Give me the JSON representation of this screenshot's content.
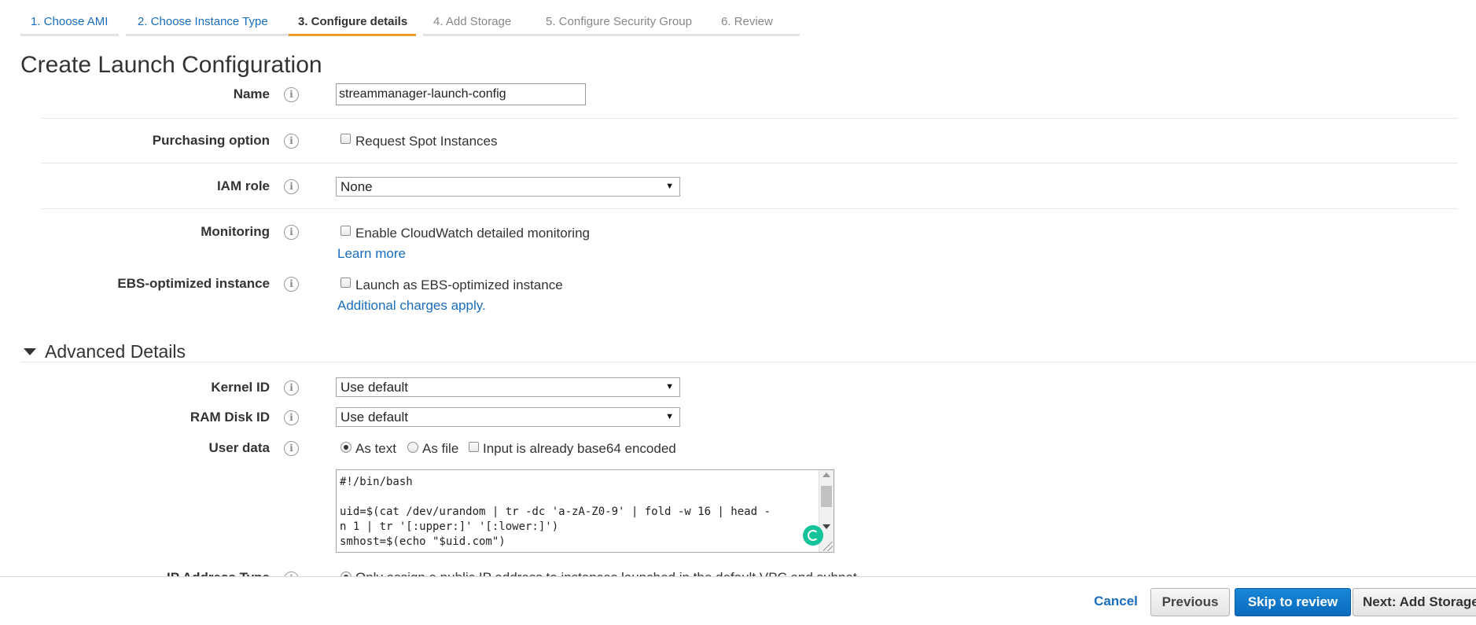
{
  "wizard": {
    "steps": [
      {
        "label": "1. Choose AMI",
        "state": "done"
      },
      {
        "label": "2. Choose Instance Type",
        "state": "done"
      },
      {
        "label": "3. Configure details",
        "state": "active"
      },
      {
        "label": "4. Add Storage",
        "state": "future"
      },
      {
        "label": "5. Configure Security Group",
        "state": "future"
      },
      {
        "label": "6. Review",
        "state": "future"
      }
    ]
  },
  "page": {
    "title": "Create Launch Configuration"
  },
  "form": {
    "name": {
      "label": "Name",
      "value": "streammanager-launch-config"
    },
    "purchasing": {
      "label": "Purchasing option",
      "option": "Request Spot Instances",
      "checked": false
    },
    "iam_role": {
      "label": "IAM role",
      "selected": "None"
    },
    "monitoring": {
      "label": "Monitoring",
      "option": "Enable CloudWatch detailed monitoring",
      "link": "Learn more",
      "checked": false
    },
    "ebs": {
      "label": "EBS-optimized instance",
      "option": "Launch as EBS-optimized instance",
      "link": "Additional charges apply.",
      "checked": false
    }
  },
  "advanced": {
    "heading": "Advanced Details",
    "kernel_id": {
      "label": "Kernel ID",
      "selected": "Use default"
    },
    "ram_disk_id": {
      "label": "RAM Disk ID",
      "selected": "Use default"
    },
    "user_data": {
      "label": "User data",
      "as_text": "As text",
      "as_file": "As file",
      "base64": "Input is already base64 encoded",
      "selected": "As text",
      "content": "#!/bin/bash\n\nuid=$(cat /dev/urandom | tr -dc 'a-zA-Z0-9' | fold -w 16 | head -\nn 1 | tr '[:upper:]' '[:lower:]')\nsmhost=$(echo \"$uid.com\")"
    },
    "ip_address_type": {
      "label": "IP Address Type",
      "option": "Only assign a public IP address to instances launched in the default VPC and subnet."
    }
  },
  "footer": {
    "cancel": "Cancel",
    "previous": "Previous",
    "skip": "Skip to review",
    "next": "Next: Add Storage"
  },
  "icons": {
    "info": "info-icon",
    "collapse": "triangle-down-icon",
    "grammarly": "grammarly-icon"
  },
  "colors": {
    "accent_tab": "#f29a2e",
    "link": "#1a6dbe",
    "primary_button": "#0a6bbd"
  }
}
